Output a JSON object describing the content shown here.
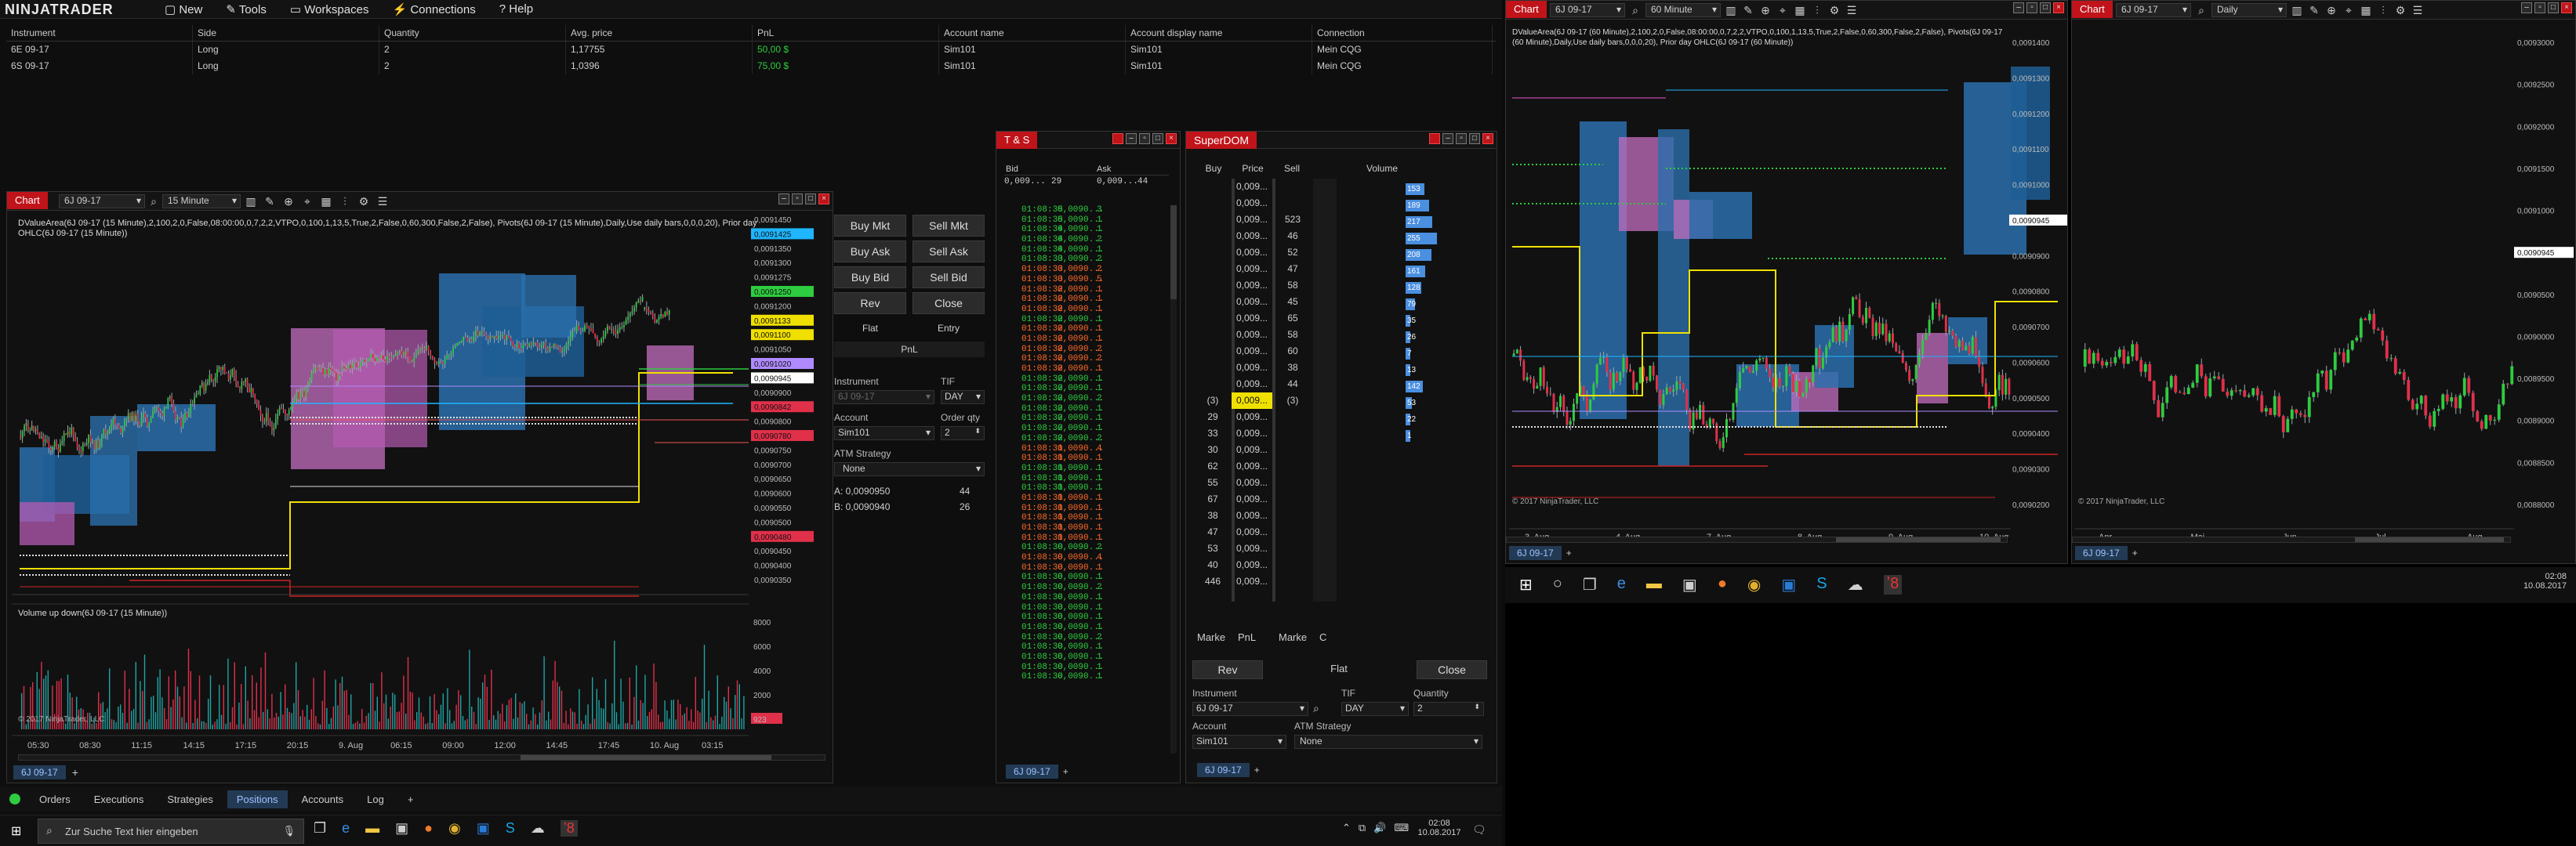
{
  "app": {
    "brand": "NINJATRADER",
    "menu": [
      "New",
      "Tools",
      "Workspaces",
      "Connections",
      "Help"
    ]
  },
  "positions": {
    "headers": [
      "Instrument",
      "Side",
      "Quantity",
      "Avg. price",
      "PnL",
      "Account name",
      "Account display name",
      "Connection"
    ],
    "rows": [
      [
        "6E 09-17",
        "Long",
        "2",
        "1,17755",
        "50,00 $",
        "Sim101",
        "Sim101",
        "Mein CQG"
      ],
      [
        "6S 09-17",
        "Long",
        "2",
        "1,0396",
        "75,00 $",
        "Sim101",
        "Sim101",
        "Mein CQG"
      ]
    ]
  },
  "bottom_tabs": [
    "Orders",
    "Executions",
    "Strategies",
    "Positions",
    "Accounts",
    "Log",
    "+"
  ],
  "chart1": {
    "title": "Chart",
    "instrument": "6J 09-17",
    "interval": "15 Minute",
    "indicator_text": "DValueArea(6J 09-17 (15 Minute),2,100,2,0,False,08:00:00,0,7,2,2,VTPO,0,100,1,13,5,True,2,False,0,60,300,False,2,False), Pivots(6J 09-17 (15 Minute),Daily,Use daily bars,0,0,0,20), Prior day OHLC(6J 09-17 (15 Minute))",
    "copyright": "© 2017 NinjaTrader, LLC",
    "volume_label": "Volume up down(6J 09-17 (15 Minute))",
    "x_ticks": [
      "05:30",
      "08:30",
      "11:15",
      "14:15",
      "17:15",
      "20:15",
      "9. Aug",
      "06:15",
      "09:00",
      "12:00",
      "14:45",
      "17:45",
      "10. Aug",
      "03:15"
    ],
    "y_ticks": [
      "0,0091450",
      "0,0091425",
      "0,0091350",
      "0,0091300",
      "0,0091275",
      "0,0091250",
      "0,0091200",
      "0,0091133",
      "0,0091100",
      "0,0091050",
      "0,0091020",
      "0,0090945",
      "0,0090900",
      "0,0090842",
      "0,0090800",
      "0,0090780",
      "0,0090750",
      "0,0090700",
      "0,0090650",
      "0,0090600",
      "0,0090550",
      "0,0090500",
      "0,0090480",
      "0,0090450",
      "0,0090400",
      "0,0090350"
    ],
    "vol_ticks": [
      "8000",
      "6000",
      "4000",
      "2000",
      "923"
    ],
    "tab": "6J 09-17"
  },
  "chart_trader": {
    "buy_mkt": "Buy Mkt",
    "sell_mkt": "Sell Mkt",
    "buy_ask": "Buy Ask",
    "sell_ask": "Sell Ask",
    "buy_bid": "Buy Bid",
    "sell_bid": "Sell Bid",
    "rev": "Rev",
    "close": "Close",
    "flat": "Flat",
    "entry": "Entry",
    "pnl": "PnL",
    "instrument_label": "Instrument",
    "instrument_value": "6J 09-17",
    "tif_label": "TIF",
    "tif_value": "DAY",
    "account_label": "Account",
    "account_value": "Sim101",
    "qty_label": "Order qty",
    "qty_value": "2",
    "atm_label": "ATM Strategy",
    "atm_value": "None",
    "ask_line": "A: 0,0090950",
    "ask_size": "44",
    "bid_line": "B: 0,0090940",
    "bid_size": "26"
  },
  "ts": {
    "title": "T & S",
    "bid_label": "Bid",
    "ask_label": "Ask",
    "bid_price": "0,009...",
    "bid_size": "29",
    "ask_price": "0,009...",
    "ask_size": "44",
    "tab": "6J 09-17",
    "rows": [
      [
        "01:08:35",
        "0,0090...",
        "3",
        "g"
      ],
      [
        "01:08:35",
        "0,0090...",
        "1",
        "g"
      ],
      [
        "01:08:34",
        "0,0090...",
        "1",
        "g"
      ],
      [
        "01:08:34",
        "0,0090...",
        "2",
        "g"
      ],
      [
        "01:08:34",
        "0,0090...",
        "1",
        "g"
      ],
      [
        "01:08:33",
        "0,0090...",
        "2",
        "g"
      ],
      [
        "01:08:33",
        "0,0090...",
        "2",
        "r"
      ],
      [
        "01:08:33",
        "0,0090...",
        "5",
        "r"
      ],
      [
        "01:08:32",
        "0,0090...",
        "1",
        "r"
      ],
      [
        "01:08:32",
        "0,0090...",
        "1",
        "r"
      ],
      [
        "01:08:32",
        "0,0090...",
        "1",
        "r"
      ],
      [
        "01:08:32",
        "0,0090...",
        "1",
        "g"
      ],
      [
        "01:08:32",
        "0,0090...",
        "1",
        "r"
      ],
      [
        "01:08:32",
        "0,0090...",
        "1",
        "r"
      ],
      [
        "01:08:32",
        "0,0090...",
        "2",
        "r"
      ],
      [
        "01:08:32",
        "0,0090...",
        "2",
        "r"
      ],
      [
        "01:08:32",
        "0,0090...",
        "1",
        "r"
      ],
      [
        "01:08:32",
        "0,0090...",
        "1",
        "g"
      ],
      [
        "01:08:32",
        "0,0090...",
        "1",
        "g"
      ],
      [
        "01:08:32",
        "0,0090...",
        "2",
        "g"
      ],
      [
        "01:08:32",
        "0,0090...",
        "1",
        "g"
      ],
      [
        "01:08:32",
        "0,0090...",
        "1",
        "g"
      ],
      [
        "01:08:32",
        "0,0090...",
        "1",
        "g"
      ],
      [
        "01:08:32",
        "0,0090...",
        "2",
        "g"
      ],
      [
        "01:08:31",
        "0,0090...",
        "4",
        "r"
      ],
      [
        "01:08:31",
        "0,0090...",
        "1",
        "r"
      ],
      [
        "01:08:31",
        "0,0090...",
        "1",
        "g"
      ],
      [
        "01:08:31",
        "0,0090...",
        "1",
        "g"
      ],
      [
        "01:08:31",
        "0,0090...",
        "1",
        "g"
      ],
      [
        "01:08:31",
        "0,0090...",
        "1",
        "r"
      ],
      [
        "01:08:31",
        "0,0090...",
        "1",
        "r"
      ],
      [
        "01:08:31",
        "0,0090...",
        "1",
        "r"
      ],
      [
        "01:08:31",
        "0,0090...",
        "1",
        "r"
      ],
      [
        "01:08:31",
        "0,0090...",
        "1",
        "r"
      ],
      [
        "01:08:30",
        "0,0090...",
        "2",
        "g"
      ],
      [
        "01:08:30",
        "0,0090...",
        "4",
        "r"
      ],
      [
        "01:08:30",
        "0,0090...",
        "1",
        "r"
      ],
      [
        "01:08:30",
        "0,0090...",
        "1",
        "g"
      ],
      [
        "01:08:30",
        "0,0090...",
        "2",
        "g"
      ],
      [
        "01:08:30",
        "0,0090...",
        "1",
        "g"
      ],
      [
        "01:08:30",
        "0,0090...",
        "1",
        "g"
      ],
      [
        "01:08:30",
        "0,0090...",
        "1",
        "g"
      ],
      [
        "01:08:30",
        "0,0090...",
        "1",
        "g"
      ],
      [
        "01:08:30",
        "0,0090...",
        "2",
        "g"
      ],
      [
        "01:08:30",
        "0,0090...",
        "1",
        "g"
      ],
      [
        "01:08:30",
        "0,0090...",
        "1",
        "g"
      ],
      [
        "01:08:30",
        "0,0090...",
        "1",
        "g"
      ],
      [
        "01:08:30",
        "0,0090...",
        "1",
        "g"
      ]
    ]
  },
  "superdom": {
    "title": "SuperDOM",
    "headers": [
      "Buy",
      "Price",
      "Sell",
      "Volume"
    ],
    "rows": [
      [
        "",
        "0,009...",
        "",
        ""
      ],
      [
        "",
        "0,009...",
        "",
        ""
      ],
      [
        "",
        "0,009...",
        "523",
        ""
      ],
      [
        "",
        "0,009...",
        "46",
        ""
      ],
      [
        "",
        "0,009...",
        "52",
        ""
      ],
      [
        "",
        "0,009...",
        "47",
        ""
      ],
      [
        "",
        "0,009...",
        "58",
        ""
      ],
      [
        "",
        "0,009...",
        "45",
        ""
      ],
      [
        "",
        "0,009...",
        "65",
        ""
      ],
      [
        "",
        "0,009...",
        "58",
        ""
      ],
      [
        "",
        "0,009...",
        "60",
        ""
      ],
      [
        "",
        "0,009...",
        "38",
        ""
      ],
      [
        "",
        "0,009...",
        "44",
        ""
      ],
      [
        "(3)",
        "0,009...",
        "(3)",
        ""
      ],
      [
        "29",
        "0,009...",
        "",
        ""
      ],
      [
        "33",
        "0,009...",
        "",
        ""
      ],
      [
        "30",
        "0,009...",
        "",
        ""
      ],
      [
        "62",
        "0,009...",
        "",
        ""
      ],
      [
        "55",
        "0,009...",
        "",
        ""
      ],
      [
        "67",
        "0,009...",
        "",
        ""
      ],
      [
        "38",
        "0,009...",
        "",
        ""
      ],
      [
        "47",
        "0,009...",
        "",
        ""
      ],
      [
        "53",
        "0,009...",
        "",
        ""
      ],
      [
        "40",
        "0,009...",
        "",
        ""
      ],
      [
        "446",
        "0,009...",
        "",
        ""
      ]
    ],
    "volumes": [
      "153",
      "189",
      "217",
      "255",
      "208",
      "161",
      "128",
      "79",
      "35",
      "26",
      "7",
      "13",
      "142",
      "53",
      "22",
      "1"
    ],
    "market": "Marke",
    "pnl": "PnL",
    "market2": "Marke",
    "c": "C",
    "rev": "Rev",
    "flat": "Flat",
    "close": "Close",
    "instrument_label": "Instrument",
    "instrument_value": "6J 09-17",
    "tif_label": "TIF",
    "tif_value": "DAY",
    "qty_label": "Quantity",
    "qty_value": "2",
    "account_label": "Account",
    "account_value": "Sim101",
    "atm_label": "ATM Strategy",
    "atm_value": "None",
    "tab": "6J 09-17"
  },
  "chart2": {
    "title": "Chart",
    "instrument": "6J 09-17",
    "interval": "60 Minute",
    "indicator_text": "DValueArea(6J 09-17 (60 Minute),2,100,2,0,False,08:00:00,0,7,2,2,VTPO,0,100,1,13,5,True,2,False,0,60,300,False,2,False), Pivots(6J 09-17 (60 Minute),Daily,Use daily bars,0,0,0,20), Prior day OHLC(6J 09-17 (60 Minute))",
    "copyright": "© 2017 NinjaTrader, LLC",
    "x_ticks": [
      "3. Aug",
      "4. Aug",
      "7. Aug",
      "8. Aug",
      "9. Aug",
      "10. Aug"
    ],
    "y_ticks": [
      "0,0091400",
      "0,0091300",
      "0,0091200",
      "0,0091100",
      "0,0091000",
      "0,0090945",
      "0,0090900",
      "0,0090800",
      "0,0090700",
      "0,0090600",
      "0,0090500",
      "0,0090400",
      "0,0090300",
      "0,0090200"
    ],
    "tab": "6J 09-17"
  },
  "chart3": {
    "title": "Chart",
    "instrument": "6J 09-17",
    "interval": "Daily",
    "copyright": "© 2017 NinjaTrader, LLC",
    "x_ticks": [
      "Apr",
      "Mai",
      "Jun",
      "Jul",
      "Aug"
    ],
    "y_ticks": [
      "0,0093000",
      "0,0092500",
      "0,0092000",
      "0,0091500",
      "0,0091000",
      "0,0090945",
      "0,0090500",
      "0,0090000",
      "0,0089500",
      "0,0089000",
      "0,0088500",
      "0,0088000"
    ],
    "tab": "6J 09-17"
  },
  "taskbar_left": {
    "search_placeholder": "Zur Suche Text hier eingeben",
    "time": "02:08",
    "date": "10.08.2017"
  },
  "taskbar_right": {
    "time": "02:08",
    "date": "10.08.2017"
  }
}
